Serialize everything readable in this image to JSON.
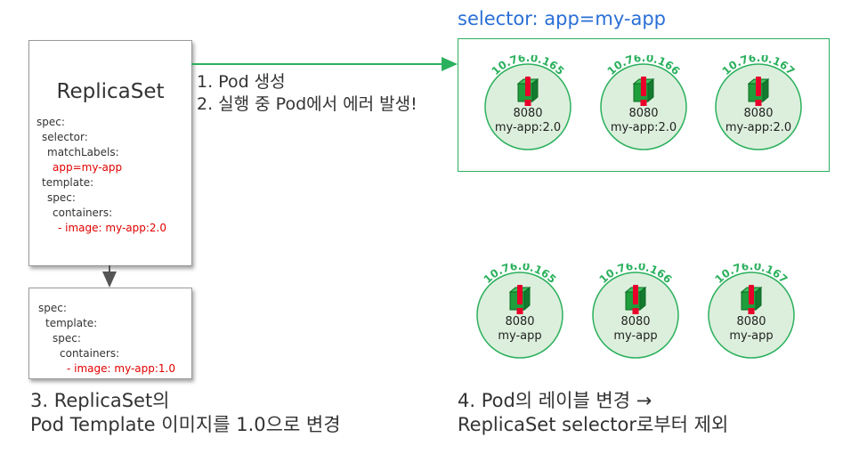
{
  "replicaset_box": {
    "title": "ReplicaSet",
    "spec_lines": [
      {
        "text": "spec:",
        "indent": 0,
        "highlight": false
      },
      {
        "text": "selector:",
        "indent": 1,
        "highlight": false
      },
      {
        "text": "matchLabels:",
        "indent": 2,
        "highlight": false
      },
      {
        "text": "app=my-app",
        "indent": 3,
        "highlight": true
      },
      {
        "text": "template:",
        "indent": 1,
        "highlight": false
      },
      {
        "text": "spec:",
        "indent": 2,
        "highlight": false
      },
      {
        "text": "containers:",
        "indent": 3,
        "highlight": false
      },
      {
        "text": "- image: my-app:2.0",
        "indent": 4,
        "highlight": true
      }
    ]
  },
  "template_box": {
    "spec_lines": [
      {
        "text": "spec:",
        "indent": 0,
        "highlight": false
      },
      {
        "text": "template:",
        "indent": 1,
        "highlight": false
      },
      {
        "text": "spec:",
        "indent": 2,
        "highlight": false
      },
      {
        "text": "containers:",
        "indent": 3,
        "highlight": false
      },
      {
        "text": "- image: my-app:1.0",
        "indent": 4,
        "highlight": true
      }
    ]
  },
  "arrow_annotation": {
    "line1": "1. Pod 생성",
    "line2": "2. 실행 중 Pod에서 에러 발생!"
  },
  "selector": {
    "label": "selector: app=my-app"
  },
  "top_pods": [
    {
      "ip": "10.76.0.165",
      "port": "8080",
      "label": "my-app:2.0",
      "error": true
    },
    {
      "ip": "10.76.0.166",
      "port": "8080",
      "label": "my-app:2.0",
      "error": true
    },
    {
      "ip": "10.76.0.167",
      "port": "8080",
      "label": "my-app:2.0",
      "error": true
    }
  ],
  "bottom_pods": [
    {
      "ip": "10.76.0.165",
      "port": "8080",
      "label": "my-app",
      "error": true
    },
    {
      "ip": "10.76.0.166",
      "port": "8080",
      "label": "my-app",
      "error": true
    },
    {
      "ip": "10.76.0.167",
      "port": "8080",
      "label": "my-app",
      "error": true
    }
  ],
  "caption_left": {
    "line1": "3. ReplicaSet의",
    "line2": "Pod Template 이미지를 1.0으로 변경"
  },
  "caption_right": {
    "line1": "4. Pod의 레이블 변경 →",
    "line2": "ReplicaSet selector로부터 제외"
  },
  "colors": {
    "pod_fill": "#dcefdc",
    "pod_stroke": "#2bb05d",
    "cube": "#1f9e3c",
    "error": "#e8002a",
    "arrow_green": "#2bb05d",
    "arrow_gray": "#555555",
    "selector_text": "#2a6fd6",
    "highlight_text": "#e00000"
  }
}
